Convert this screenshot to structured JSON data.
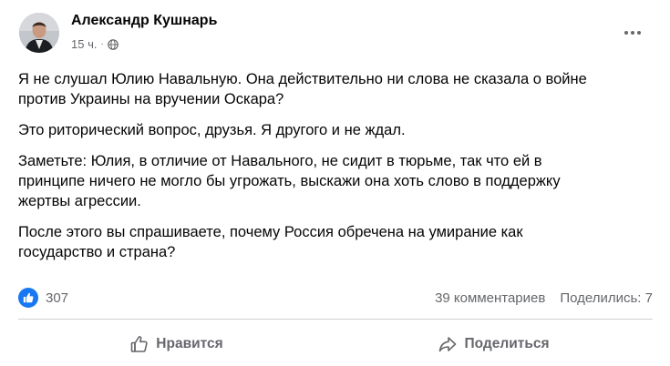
{
  "author": {
    "name": "Александр Кушнарь",
    "time": "15 ч.",
    "separator": "·",
    "audience_icon": "globe-icon"
  },
  "post": {
    "paragraphs": [
      "Я не слушал Юлию Навальную. Она действительно ни слова не сказала о войне\nпротив Украины на вручении Оскара?",
      "Это риторический вопрос, друзья. Я другого и не ждал.",
      "Заметьте: Юлия, в отличие от Навального, не сидит в тюрьме, так что ей в\nпринципе ничего не могло бы угрожать, выскажи она хоть слово в поддержку\nжертвы агрессии.",
      "После этого вы спрашиваете, почему Россия обречена на умирание как\nгосударство и страна?"
    ]
  },
  "stats": {
    "reaction_icon": "like-icon",
    "likes": "307",
    "comments": "39 комментариев",
    "shares": "Поделились: 7"
  },
  "actions": {
    "like_label": "Нравится",
    "share_label": "Поделиться"
  },
  "colors": {
    "accent": "#1877f2",
    "secondary_text": "#65676b",
    "divider": "#ced0d4"
  }
}
